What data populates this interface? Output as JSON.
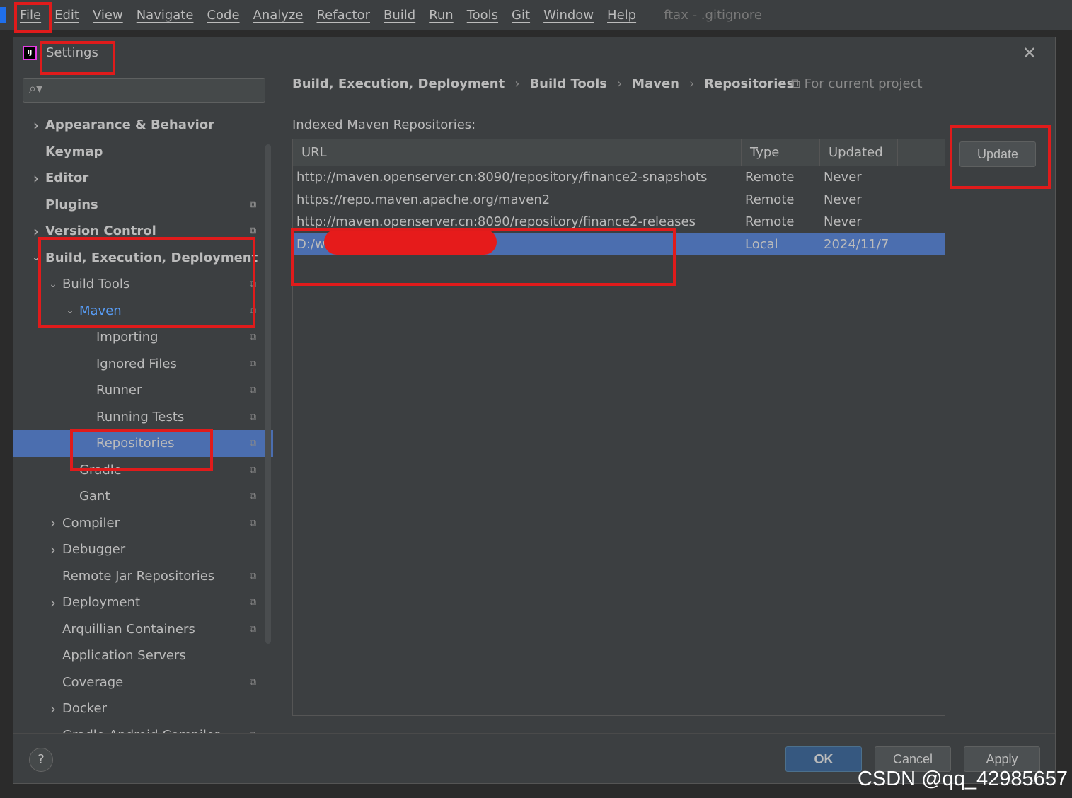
{
  "menubar": {
    "items": [
      "File",
      "Edit",
      "View",
      "Navigate",
      "Code",
      "Analyze",
      "Refactor",
      "Build",
      "Run",
      "Tools",
      "Git",
      "Window",
      "Help"
    ],
    "title": "ftax - .gitignore"
  },
  "dialog": {
    "title": "Settings",
    "icon": "intellij-idea-icon"
  },
  "sidebar": {
    "search_placeholder": "",
    "tree": [
      {
        "label": "Appearance & Behavior",
        "level": 0,
        "expander": "collapsed",
        "bold": true,
        "project": false
      },
      {
        "label": "Keymap",
        "level": 0,
        "expander": "none",
        "bold": true,
        "project": false
      },
      {
        "label": "Editor",
        "level": 0,
        "expander": "collapsed",
        "bold": true,
        "project": false
      },
      {
        "label": "Plugins",
        "level": 0,
        "expander": "none",
        "bold": true,
        "project": true
      },
      {
        "label": "Version Control",
        "level": 0,
        "expander": "collapsed",
        "bold": true,
        "project": true
      },
      {
        "label": "Build, Execution, Deployment",
        "level": 0,
        "expander": "expanded",
        "bold": true,
        "project": false
      },
      {
        "label": "Build Tools",
        "level": 1,
        "expander": "expanded",
        "bold": false,
        "project": true
      },
      {
        "label": "Maven",
        "level": 2,
        "expander": "expanded",
        "bold": false,
        "project": true,
        "highlight": true
      },
      {
        "label": "Importing",
        "level": 3,
        "expander": "none",
        "project": true
      },
      {
        "label": "Ignored Files",
        "level": 3,
        "expander": "none",
        "project": true
      },
      {
        "label": "Runner",
        "level": 3,
        "expander": "none",
        "project": true
      },
      {
        "label": "Running Tests",
        "level": 3,
        "expander": "none",
        "project": true
      },
      {
        "label": "Repositories",
        "level": 3,
        "expander": "none",
        "project": true,
        "selected": true
      },
      {
        "label": "Gradle",
        "level": 2,
        "expander": "none",
        "project": true
      },
      {
        "label": "Gant",
        "level": 2,
        "expander": "none",
        "project": true
      },
      {
        "label": "Compiler",
        "level": 1,
        "expander": "collapsed",
        "project": true
      },
      {
        "label": "Debugger",
        "level": 1,
        "expander": "collapsed",
        "project": false
      },
      {
        "label": "Remote Jar Repositories",
        "level": 1,
        "expander": "none",
        "project": true
      },
      {
        "label": "Deployment",
        "level": 1,
        "expander": "collapsed",
        "project": true
      },
      {
        "label": "Arquillian Containers",
        "level": 1,
        "expander": "none",
        "project": true
      },
      {
        "label": "Application Servers",
        "level": 1,
        "expander": "none",
        "project": false
      },
      {
        "label": "Coverage",
        "level": 1,
        "expander": "none",
        "project": true
      },
      {
        "label": "Docker",
        "level": 1,
        "expander": "collapsed",
        "project": false
      },
      {
        "label": "Gradle-Android Compiler",
        "level": 1,
        "expander": "none",
        "project": true
      }
    ]
  },
  "main": {
    "breadcrumb": [
      "Build, Execution, Deployment",
      "Build Tools",
      "Maven",
      "Repositories"
    ],
    "scope": "For current project",
    "section_label": "Indexed Maven Repositories:",
    "table": {
      "columns": [
        "URL",
        "Type",
        "Updated"
      ],
      "rows": [
        [
          "http://maven.openserver.cn:8090/repository/finance2-snapshots",
          "Remote",
          "Never"
        ],
        [
          "https://repo.maven.apache.org/maven2",
          "Remote",
          "Never"
        ],
        [
          "http://maven.openserver.cn:8090/repository/finance2-releases",
          "Remote",
          "Never"
        ],
        [
          "D:/w maven_repo",
          "Local",
          "2024/11/7"
        ]
      ],
      "selected_row": 3
    },
    "update_label": "Update"
  },
  "footer": {
    "help": "?",
    "ok": "OK",
    "cancel": "Cancel",
    "apply": "Apply"
  },
  "watermark": "CSDN @qq_42985657",
  "colors": {
    "selection": "#4b6eaf",
    "annotation": "#e01b1b",
    "link": "#589df6"
  }
}
